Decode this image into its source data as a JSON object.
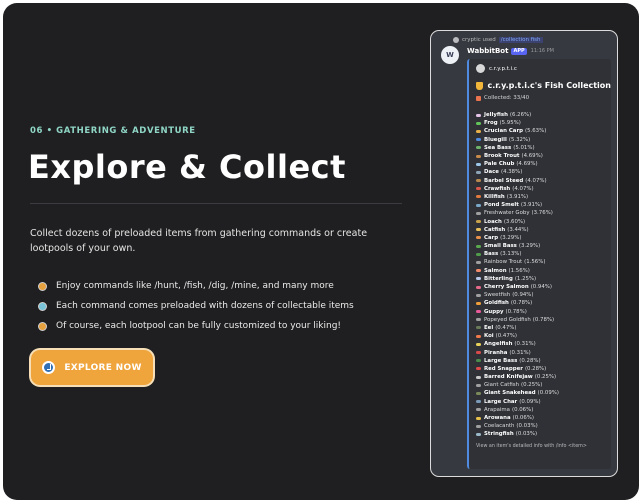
{
  "hero": {
    "eyebrow": "06 • GATHERING & ADVENTURE",
    "title": "Explore & Collect",
    "description": "Collect dozens of preloaded items from gathering commands or create lootpools of your own.",
    "bullets": [
      {
        "text": "Enjoy commands like /hunt, /fish, /dig, /mine, and many more",
        "color": "#e6a23e"
      },
      {
        "text": "Each command comes preloaded with dozens of collectable items",
        "color": "#79c4d8"
      },
      {
        "text": "Of course, each lootpool can be fully customized to your liking!",
        "color": "#e6a23e"
      }
    ],
    "button_label": "EXPLORE NOW"
  },
  "discord": {
    "reply_user": "cryptic used",
    "reply_command": "/collection fish",
    "bot_name": "WabbitBot",
    "bot_avatar_text": "W",
    "app_badge": "APP",
    "time": "11:16 PM",
    "author": "c.r.y.p.t.i.c",
    "embed_title": "c.r.y.p.t.i.c's Fish Collection",
    "collected": "Collected: 33/40",
    "footer": "View an item's detailed info with /info <item>",
    "fish": [
      {
        "name": "Jellyfish",
        "pct": "(6.26%)",
        "bold": true,
        "color": "#e6c3e8"
      },
      {
        "name": "Frog",
        "pct": "(5.95%)",
        "bold": true,
        "color": "#62c35a"
      },
      {
        "name": "Crucian Carp",
        "pct": "(5.63%)",
        "bold": true,
        "color": "#e8b04a"
      },
      {
        "name": "Bluegill",
        "pct": "(5.32%)",
        "bold": true,
        "color": "#4f8be0"
      },
      {
        "name": "Sea Bass",
        "pct": "(5.01%)",
        "bold": true,
        "color": "#6fb36a"
      },
      {
        "name": "Brook Trout",
        "pct": "(4.69%)",
        "bold": true,
        "color": "#c98b4a"
      },
      {
        "name": "Pale Chub",
        "pct": "(4.69%)",
        "bold": true,
        "color": "#9cc7e8"
      },
      {
        "name": "Dace",
        "pct": "(4.38%)",
        "bold": true,
        "color": "#8fa6b8"
      },
      {
        "name": "Barbel Steed",
        "pct": "(4.07%)",
        "bold": true,
        "color": "#b8894f"
      },
      {
        "name": "Crawfish",
        "pct": "(4.07%)",
        "bold": true,
        "color": "#d9574a"
      },
      {
        "name": "Killfish",
        "pct": "(3.91%)",
        "bold": true,
        "color": "#e07a3e"
      },
      {
        "name": "Pond Smelt",
        "pct": "(3.91%)",
        "bold": true,
        "color": "#7aa8c8"
      },
      {
        "name": "Freshwater Goby",
        "pct": "(3.76%)",
        "bold": false,
        "color": "#a0a0a0"
      },
      {
        "name": "Loach",
        "pct": "(3.60%)",
        "bold": true,
        "color": "#c9a24a"
      },
      {
        "name": "Catfish",
        "pct": "(3.44%)",
        "bold": true,
        "color": "#e8c05a"
      },
      {
        "name": "Carp",
        "pct": "(3.29%)",
        "bold": true,
        "color": "#e8904a"
      },
      {
        "name": "Small Bass",
        "pct": "(3.29%)",
        "bold": true,
        "color": "#5aa84f"
      },
      {
        "name": "Bass",
        "pct": "(3.13%)",
        "bold": true,
        "color": "#4f9c4a"
      },
      {
        "name": "Rainbow Trout",
        "pct": "(1.56%)",
        "bold": false,
        "color": "#a0a0a0"
      },
      {
        "name": "Salmon",
        "pct": "(1.56%)",
        "bold": true,
        "color": "#f08a6a"
      },
      {
        "name": "Bitterling",
        "pct": "(1.25%)",
        "bold": true,
        "color": "#b8c8e8"
      },
      {
        "name": "Cherry Salmon",
        "pct": "(0.94%)",
        "bold": true,
        "color": "#e86a8a"
      },
      {
        "name": "Sweetfish",
        "pct": "(0.94%)",
        "bold": false,
        "color": "#a0a0a0"
      },
      {
        "name": "Goldfish",
        "pct": "(0.78%)",
        "bold": true,
        "color": "#f0a03a"
      },
      {
        "name": "Guppy",
        "pct": "(0.78%)",
        "bold": true,
        "color": "#e85a9a"
      },
      {
        "name": "Popeyed Goldfish",
        "pct": "(0.78%)",
        "bold": false,
        "color": "#a0a0a0"
      },
      {
        "name": "Eel",
        "pct": "(0.47%)",
        "bold": true,
        "color": "#6a7a5a"
      },
      {
        "name": "Koi",
        "pct": "(0.47%)",
        "bold": true,
        "color": "#f07a4a"
      },
      {
        "name": "Angelfish",
        "pct": "(0.31%)",
        "bold": true,
        "color": "#e8d05a"
      },
      {
        "name": "Piranha",
        "pct": "(0.31%)",
        "bold": true,
        "color": "#d94a4a"
      },
      {
        "name": "Large Bass",
        "pct": "(0.28%)",
        "bold": true,
        "color": "#4a8c4a"
      },
      {
        "name": "Red Snapper",
        "pct": "(0.28%)",
        "bold": true,
        "color": "#e04a4a"
      },
      {
        "name": "Barred Knifejaw",
        "pct": "(0.25%)",
        "bold": true,
        "color": "#c8c8c8"
      },
      {
        "name": "Giant Catfish",
        "pct": "(0.25%)",
        "bold": false,
        "color": "#a0a0a0"
      },
      {
        "name": "Giant Snakehead",
        "pct": "(0.09%)",
        "bold": true,
        "color": "#7a8a5a"
      },
      {
        "name": "Large Char",
        "pct": "(0.09%)",
        "bold": true,
        "color": "#7a9ab8"
      },
      {
        "name": "Arapaima",
        "pct": "(0.06%)",
        "bold": false,
        "color": "#a0a0a0"
      },
      {
        "name": "Arowana",
        "pct": "(0.06%)",
        "bold": true,
        "color": "#e8c04a"
      },
      {
        "name": "Coelacanth",
        "pct": "(0.03%)",
        "bold": false,
        "color": "#a0a0a0"
      },
      {
        "name": "Stringfish",
        "pct": "(0.03%)",
        "bold": true,
        "color": "#9ab8c8"
      }
    ]
  }
}
